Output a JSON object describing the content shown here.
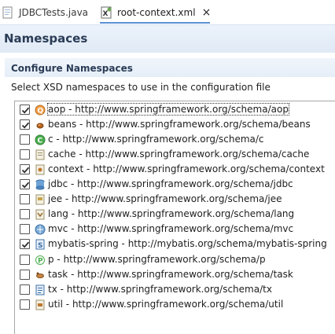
{
  "tabs": [
    {
      "label": "JDBCTests.java",
      "icon": "java-file-icon",
      "active": false
    },
    {
      "label": "root-context.xml",
      "icon": "xml-file-icon",
      "active": true,
      "close": "×"
    }
  ],
  "header": {
    "title": "Namespaces"
  },
  "section": {
    "title": "Configure Namespaces",
    "description": "Select XSD namespaces to use in the configuration file"
  },
  "namespaces": [
    {
      "label": "aop - http://www.springframework.org/schema/aop",
      "checked": true,
      "icon": "aop-icon"
    },
    {
      "label": "beans - http://www.springframework.org/schema/beans",
      "checked": true,
      "icon": "beans-icon"
    },
    {
      "label": "c - http://www.springframework.org/schema/c",
      "checked": false,
      "icon": "c-namespace-icon"
    },
    {
      "label": "cache - http://www.springframework.org/schema/cache",
      "checked": false,
      "icon": "cache-icon"
    },
    {
      "label": "context - http://www.springframework.org/schema/context",
      "checked": true,
      "icon": "context-icon"
    },
    {
      "label": "jdbc - http://www.springframework.org/schema/jdbc",
      "checked": true,
      "icon": "jdbc-icon"
    },
    {
      "label": "jee - http://www.springframework.org/schema/jee",
      "checked": false,
      "icon": "jee-icon"
    },
    {
      "label": "lang - http://www.springframework.org/schema/lang",
      "checked": false,
      "icon": "lang-icon"
    },
    {
      "label": "mvc - http://www.springframework.org/schema/mvc",
      "checked": false,
      "icon": "mvc-icon"
    },
    {
      "label": "mybatis-spring - http://mybatis.org/schema/mybatis-spring",
      "checked": true,
      "icon": "mybatis-icon"
    },
    {
      "label": "p - http://www.springframework.org/schema/p",
      "checked": false,
      "icon": "p-namespace-icon"
    },
    {
      "label": "task - http://www.springframework.org/schema/task",
      "checked": false,
      "icon": "task-icon"
    },
    {
      "label": "tx - http://www.springframework.org/schema/tx",
      "checked": false,
      "icon": "tx-icon"
    },
    {
      "label": "util - http://www.springframework.org/schema/util",
      "checked": false,
      "icon": "util-icon"
    }
  ],
  "colors": {
    "accent": "#5c8fd6",
    "header_text": "#2a3c56",
    "header_bg": "#dfe9f5"
  }
}
